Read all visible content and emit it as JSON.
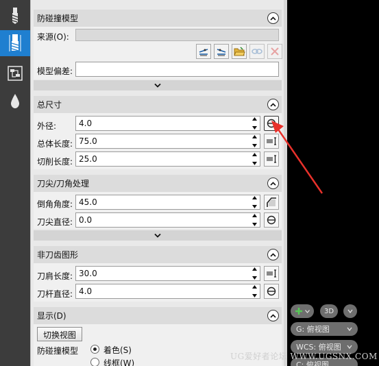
{
  "toolbar": {
    "items": [
      {
        "icon": "drill-bit-icon"
      },
      {
        "icon": "mill-tool-icon",
        "active": true
      },
      {
        "icon": "holder-icon"
      },
      {
        "icon": "drop-icon"
      }
    ]
  },
  "collision_model": {
    "title": "防碰撞模型",
    "source_label": "来源(O):",
    "source_value": "",
    "offset_label": "模型偏差:",
    "offset_value": ""
  },
  "dimensions": {
    "title": "总尺寸",
    "rows": [
      {
        "label": "外径:",
        "value": "4.0"
      },
      {
        "label": "总体长度:",
        "value": "75.0"
      },
      {
        "label": "切削长度:",
        "value": "25.0"
      }
    ]
  },
  "tip": {
    "title": "刀尖/刀角处理",
    "rows": [
      {
        "label": "倒角角度:",
        "value": "45.0"
      },
      {
        "label": "刀尖直径:",
        "value": "0.0"
      }
    ]
  },
  "non_tooth": {
    "title": "非刀齿图形",
    "rows": [
      {
        "label": "刀肩长度:",
        "value": "30.0"
      },
      {
        "label": "刀杆直径:",
        "value": "4.0"
      }
    ]
  },
  "display": {
    "title": "显示(D)",
    "switch_view_label": "切换视图",
    "collision_label": "防碰撞模型",
    "options": [
      "着色(S)",
      "线框(W)"
    ]
  },
  "viewport": {
    "btn_3d": "3D",
    "view_g": "G: 俯视图",
    "view_wcs": "WCS: 俯视图",
    "view_c": "C: 俯视图"
  },
  "watermark": "UG爱好者论坛 WWW.UGSNX.COM",
  "colors": {
    "accent": "#1f7fd0",
    "arrow": "#e8312b"
  }
}
